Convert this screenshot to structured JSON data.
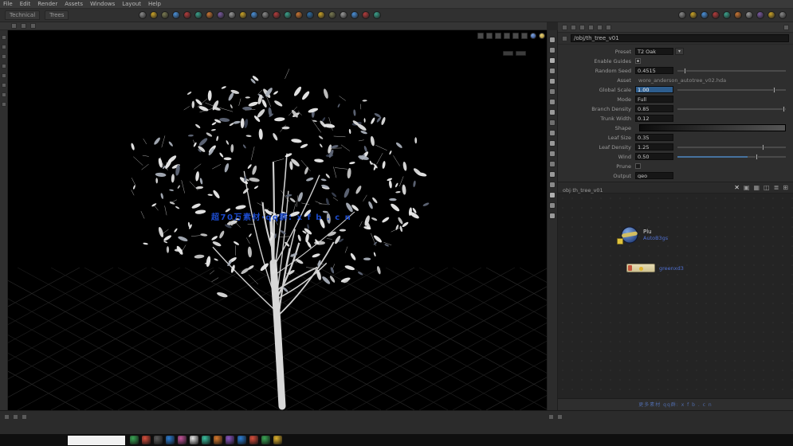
{
  "menubar": {
    "items": [
      "File",
      "Edit",
      "Render",
      "Assets",
      "Windows",
      "Layout",
      "Help"
    ]
  },
  "shelf": {
    "tabs": [
      "Technical",
      "Trees"
    ],
    "tools": [
      "#8a8a8a",
      "#c9a227",
      "#7a7a52",
      "#4a90d9",
      "#b23b3b",
      "#3aa08a",
      "#c87533",
      "#7a5aa0",
      "#999999",
      "#c9a227",
      "#4a90d9",
      "#8a8a8a",
      "#b23b3b",
      "#3aa08a",
      "#c87533",
      "#2e6da4",
      "#c9a227",
      "#7a7a52",
      "#999999",
      "#4a90d9",
      "#b23b3b",
      "#3aa08a"
    ],
    "tools_right": [
      "#888888",
      "#c9a227",
      "#4a90d9",
      "#b23b3b",
      "#3aa08a",
      "#c87533",
      "#999999",
      "#7a5aa0",
      "#c9a227",
      "#888888"
    ]
  },
  "subbar": {
    "icons": [
      "layout-icon",
      "split-icon",
      "pin-icon"
    ]
  },
  "left_toolbar": {
    "icons": [
      "select-icon",
      "translate-icon",
      "rotate-icon",
      "scale-icon",
      "handles-icon",
      "snap-icon",
      "view-icon",
      "display-icon"
    ]
  },
  "viewport": {
    "watermark": "超70万素材·qq群: x f b . c n",
    "toolbar_icons": [
      "camera-icon",
      "shade-icon",
      "wire-icon",
      "light-icon",
      "grid-icon",
      "gizmo-icon"
    ],
    "side_icons": [
      "#9a9a9a",
      "#8a8a8a",
      "#b0b0b0",
      "#8a8a8a",
      "#9a9a9a",
      "#7a7a7a",
      "#8a8a8a",
      "#9a9a9a",
      "#6f6f6f",
      "#8a8a8a",
      "#9a9a9a",
      "#8a8a8a",
      "#7a7a7a",
      "#9a9a9a",
      "#8a8a8a",
      "#b0b0b0",
      "#8a8a8a",
      "#9a9a9a"
    ]
  },
  "params": {
    "path_value": "/obj/th_tree_v01",
    "rows": [
      {
        "type": "field",
        "label": "Preset",
        "value": "T2 Oak",
        "button": "▾"
      },
      {
        "type": "check",
        "label": "Enable Guides",
        "checked": true
      },
      {
        "type": "slider",
        "label": "Random Seed",
        "value": "0.4515",
        "handle": 0.06
      },
      {
        "type": "text",
        "label": "Asset",
        "value": "wore_anderson_autotree_v02.hda"
      },
      {
        "type": "slider",
        "label": "Global Scale",
        "value": "1.00",
        "handle": 0.88,
        "highlight": true
      },
      {
        "type": "field",
        "label": "Mode",
        "value": "Full"
      },
      {
        "type": "slider",
        "label": "Branch Density",
        "value": "0.85",
        "handle": 0.97
      },
      {
        "type": "field",
        "label": "Trunk Width",
        "value": "0.12"
      },
      {
        "type": "ramp",
        "label": "Shape"
      },
      {
        "type": "field",
        "label": "Leaf Size",
        "value": "0.35"
      },
      {
        "type": "slider",
        "label": "Leaf Density",
        "value": "1.25",
        "handle": 0.78
      },
      {
        "type": "slider",
        "label": "Wind",
        "value": "0.50",
        "handle": 0.72,
        "fill": 0.65
      },
      {
        "type": "check",
        "label": "Prune",
        "checked": false
      },
      {
        "type": "field",
        "label": "Output",
        "value": "geo"
      }
    ]
  },
  "network": {
    "crumbs": [
      "obj",
      "th_tree_v01"
    ],
    "toolbar_icons": [
      "✕",
      "▣",
      "▦",
      "◫",
      "≣",
      "⊞"
    ],
    "nodes": [
      {
        "label": "Plu",
        "sublabel": "AutoB3gs"
      },
      {
        "label": "greenxd3"
      }
    ],
    "footer": "更多素材 qq群: x f b . c n"
  },
  "taskbar": {
    "icons": [
      "#3aa655",
      "#d94f3d",
      "#5a5a5a",
      "#2d7dd2",
      "#c2549a",
      "#e8e8e8",
      "#3ac0a0",
      "#d97b2e",
      "#8a56c2",
      "#2d7dd2",
      "#d94f3d",
      "#3aa655",
      "#e0b32e"
    ]
  }
}
